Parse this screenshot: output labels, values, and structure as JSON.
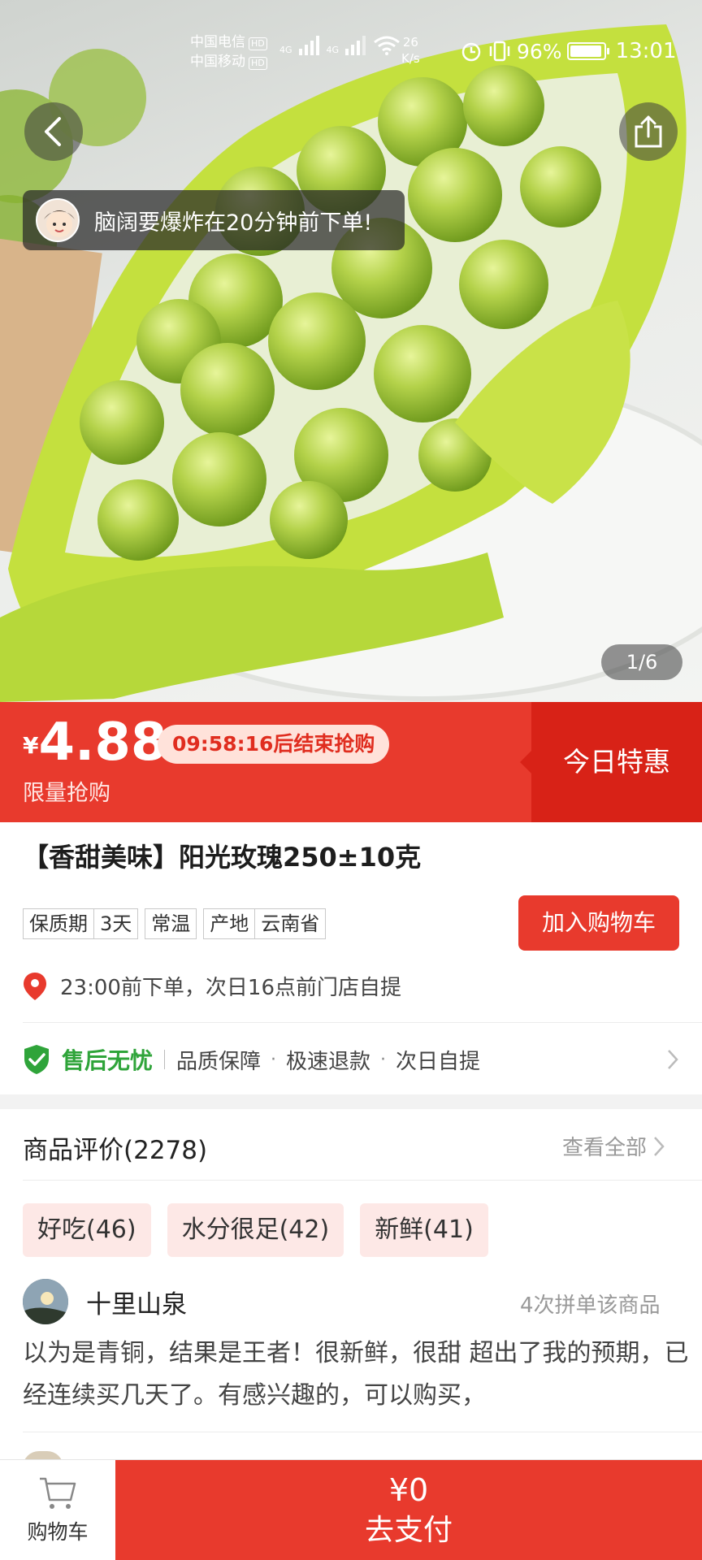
{
  "status_bar": {
    "carrier_1": "中国电信",
    "carrier_2": "中国移动",
    "hd_badge": "HD",
    "network_1": "4G",
    "network_2": "4G",
    "net_speed_value": "26",
    "net_speed_unit": "K/s",
    "battery_text": "96%",
    "battery_level": 0.96,
    "time": "13:01"
  },
  "hero": {
    "order_notice": "脑阔要爆炸在20分钟前下单!",
    "page_counter": "1/6"
  },
  "price_band": {
    "currency": "¥",
    "price": "4.88",
    "countdown": "09:58:16后结束抢购",
    "limit_label": "限量抢购",
    "today_special": "今日特惠"
  },
  "product": {
    "title": "【香甜美味】阳光玫瑰250±10克",
    "tags": [
      [
        "保质期",
        "3天"
      ],
      [
        "常温"
      ],
      [
        "产地",
        "云南省"
      ]
    ],
    "add_to_cart": "加入购物车",
    "pickup_info": "23:00前下单，次日16点前门店自提"
  },
  "service": {
    "title": "售后无忧",
    "items": [
      "品质保障",
      "极速退款",
      "次日自提"
    ],
    "separator": "·"
  },
  "reviews": {
    "title": "商品评价(2278)",
    "view_all": "查看全部",
    "tags": [
      "好吃(46)",
      "水分很足(42)",
      "新鲜(41)"
    ],
    "first_review": {
      "user": "十里山泉",
      "group_count": "4次拼单该商品",
      "text": "以为是青铜，结果是王者！很新鲜，很甜 超出了我的预期，已经连续买几天了。有感兴趣的，可以购买，"
    }
  },
  "bottom_bar": {
    "cart_label": "购物车",
    "pay_amount": "¥0",
    "pay_label": "去支付"
  },
  "colors": {
    "accent_red": "#e83a2d",
    "deep_red": "#d82217",
    "service_green": "#2fa43a",
    "tag_pink": "#fde8e6"
  }
}
